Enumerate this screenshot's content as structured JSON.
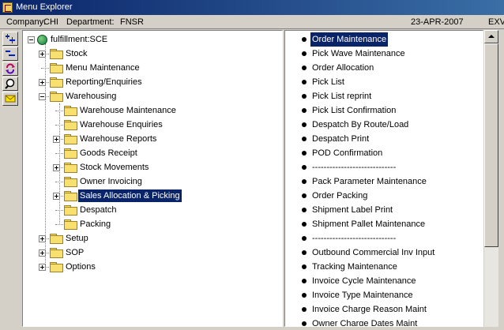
{
  "window": {
    "title": "Menu Explorer"
  },
  "info": {
    "company_label": "Company:",
    "company_value": "CHI",
    "department_label": "Department:",
    "department_value": "FNSR",
    "date": "23-APR-2007",
    "extra": "EXV"
  },
  "toolbar": {
    "buttons": [
      {
        "name": "expand-all-icon"
      },
      {
        "name": "collapse-all-icon"
      },
      {
        "name": "refresh-icon"
      },
      {
        "name": "find-icon"
      },
      {
        "name": "mail-icon"
      }
    ]
  },
  "tree": {
    "root": {
      "label": "fulfillment:SCE"
    },
    "nodes": [
      {
        "label": "Stock",
        "expander": "plus"
      },
      {
        "label": "Menu Maintenance",
        "expander": "none"
      },
      {
        "label": "Reporting/Enquiries",
        "expander": "plus"
      },
      {
        "label": "Warehousing",
        "expander": "minus"
      },
      {
        "label": "Warehouse Maintenance",
        "expander": "none"
      },
      {
        "label": "Warehouse Enquiries",
        "expander": "none"
      },
      {
        "label": "Warehouse Reports",
        "expander": "plus"
      },
      {
        "label": "Goods Receipt",
        "expander": "none"
      },
      {
        "label": "Stock Movements",
        "expander": "plus"
      },
      {
        "label": "Owner Invoicing",
        "expander": "none"
      },
      {
        "label": "Sales Allocation & Picking",
        "expander": "plus",
        "selected": true
      },
      {
        "label": "Despatch",
        "expander": "none"
      },
      {
        "label": "Packing",
        "expander": "none"
      },
      {
        "label": "Setup",
        "expander": "plus"
      },
      {
        "label": "SOP",
        "expander": "plus"
      },
      {
        "label": "Options",
        "expander": "plus"
      }
    ]
  },
  "list": {
    "items": [
      {
        "label": "Order Maintenance",
        "selected": true
      },
      {
        "label": "Pick Wave Maintenance"
      },
      {
        "label": "Order Allocation"
      },
      {
        "label": "Pick List"
      },
      {
        "label": "Pick List reprint"
      },
      {
        "label": "Pick List Confirmation"
      },
      {
        "label": "Despatch By Route/Load"
      },
      {
        "label": "Despatch Print"
      },
      {
        "label": "POD Confirmation"
      },
      {
        "label": "-----------------------------"
      },
      {
        "label": "Pack Parameter Maintenance"
      },
      {
        "label": "Order Packing"
      },
      {
        "label": "Shipment Label Print"
      },
      {
        "label": "Shipment Pallet Maintenance"
      },
      {
        "label": "-----------------------------"
      },
      {
        "label": "Outbound Commercial Inv Input"
      },
      {
        "label": "Tracking Maintenance"
      },
      {
        "label": "Invoice Cycle Maintenance"
      },
      {
        "label": "Invoice Type Maintenance"
      },
      {
        "label": "Invoice Charge Reason Maint"
      },
      {
        "label": "Owner Charge Dates Maint"
      }
    ]
  },
  "colors": {
    "selection": "#0a246a",
    "window_bg": "#d4d0c8",
    "folder": "#f8e070"
  }
}
